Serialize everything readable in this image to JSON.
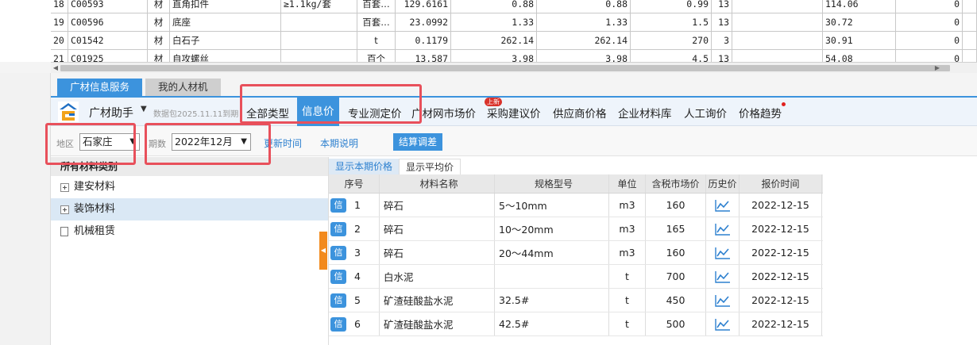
{
  "sheet": {
    "rows": [
      [
        "18",
        "C00593",
        "材",
        "直角扣件",
        "≥1.1kg/套",
        "百套…",
        "129.6161",
        "0.88",
        "0.88",
        "0.99",
        "13",
        "",
        "114.06",
        "0",
        ""
      ],
      [
        "19",
        "C00596",
        "材",
        "底座",
        "",
        "百套…",
        "23.0992",
        "1.33",
        "1.33",
        "1.5",
        "13",
        "",
        "30.72",
        "0",
        ""
      ],
      [
        "20",
        "C01542",
        "材",
        "白石子",
        "",
        "t",
        "0.1179",
        "262.14",
        "262.14",
        "270",
        "3",
        "",
        "30.91",
        "0",
        ""
      ],
      [
        "21",
        "C01925",
        "材",
        "自攻螺丝",
        "",
        "百个",
        "13.587",
        "3.98",
        "3.98",
        "4.5",
        "13",
        "",
        "54.08",
        "0",
        ""
      ]
    ]
  },
  "tabs": {
    "active": "广材信息服务",
    "inactive": "我的人材机"
  },
  "toolbar": {
    "brand": "广材助手",
    "package": "数据包2025.11.11到期",
    "nav": [
      "全部类型",
      "信息价",
      "专业测定价",
      "广材网市场价",
      "采购建议价",
      "供应商价格",
      "企业材料库",
      "人工询价",
      "价格趋势"
    ],
    "new_badge": "上新"
  },
  "filters": {
    "region_label": "地区",
    "region_value": "石家庄",
    "period_label": "期数",
    "period_value": "2022年12月",
    "update_time": "更新时间",
    "period_note": "本期说明",
    "settle_btn": "结算调差"
  },
  "tree": {
    "header": "所有材料类别",
    "items": [
      {
        "label": "建安材料",
        "type": "folder"
      },
      {
        "label": "装饰材料",
        "type": "folder"
      },
      {
        "label": "机械租赁",
        "type": "leaf"
      }
    ]
  },
  "subtabs": {
    "active": "显示本期价格",
    "inactive": "显示平均价"
  },
  "grid": {
    "columns": [
      "序号",
      "材料名称",
      "规格型号",
      "单位",
      "含税市场价",
      "历史价",
      "报价时间"
    ],
    "badge": "信",
    "rows": [
      {
        "seq": "1",
        "name": "碎石",
        "spec": "5～10mm",
        "unit": "m3",
        "price": "160",
        "date": "2022-12-15"
      },
      {
        "seq": "2",
        "name": "碎石",
        "spec": "10～20mm",
        "unit": "m3",
        "price": "165",
        "date": "2022-12-15"
      },
      {
        "seq": "3",
        "name": "碎石",
        "spec": "20～44mm",
        "unit": "m3",
        "price": "160",
        "date": "2022-12-15"
      },
      {
        "seq": "4",
        "name": "白水泥",
        "spec": "",
        "unit": "t",
        "price": "700",
        "date": "2022-12-15"
      },
      {
        "seq": "5",
        "name": "矿渣硅酸盐水泥",
        "spec": "32.5#",
        "unit": "t",
        "price": "450",
        "date": "2022-12-15"
      },
      {
        "seq": "6",
        "name": "矿渣硅酸盐水泥",
        "spec": "42.5#",
        "unit": "t",
        "price": "500",
        "date": "2022-12-15"
      }
    ]
  },
  "colors": {
    "accent": "#3c93dd",
    "highlight": "#e8505b",
    "handle": "#f28a1e"
  }
}
